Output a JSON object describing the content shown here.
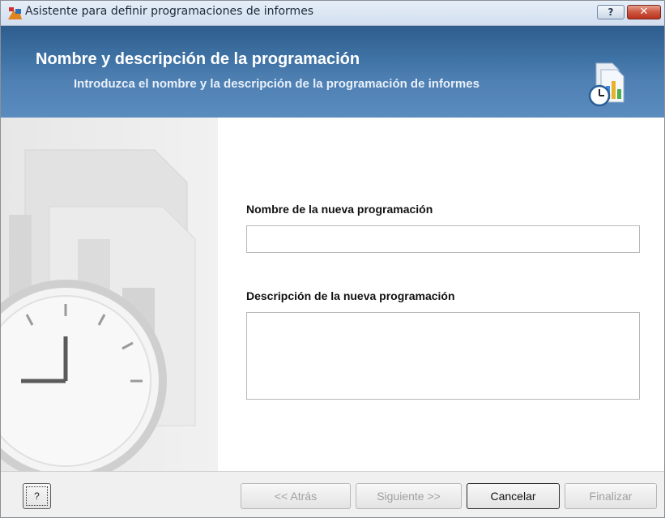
{
  "window": {
    "title": "Asistente para definir programaciones de informes",
    "help_glyph": "?",
    "close_glyph": "✕"
  },
  "banner": {
    "title": "Nombre y descripción de la programación",
    "subtitle": "Introduzca el nombre y la descripción de la programación de informes",
    "icon": "report-schedule-icon"
  },
  "form": {
    "name_label": "Nombre de la nueva programación",
    "name_value": "",
    "description_label": "Descripción de la nueva programación",
    "description_value": ""
  },
  "footer": {
    "help_label": "?",
    "back_label": "<< Atrás",
    "next_label": "Siguiente >>",
    "cancel_label": "Cancelar",
    "finish_label": "Finalizar"
  },
  "colors": {
    "banner": "#3f72a4",
    "disabled_text": "#a0a0a0"
  }
}
